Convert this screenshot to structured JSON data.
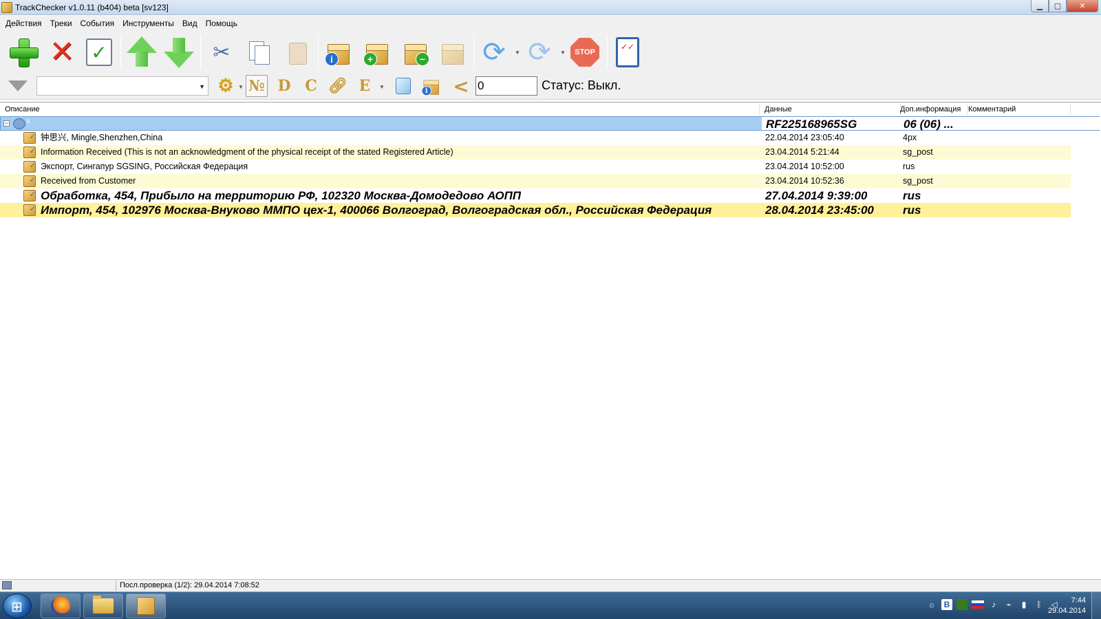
{
  "window": {
    "title": "TrackChecker v1.0.11 (b404) beta [sv123]",
    "min_glyph": "▁",
    "max_glyph": "▢",
    "close_glyph": "✕"
  },
  "menu": [
    "Действия",
    "Треки",
    "События",
    "Инструменты",
    "Вид",
    "Помощь"
  ],
  "toolbar2": {
    "filter_value": "",
    "num_button": "№",
    "d_button": "D",
    "c_button": "C",
    "e_button": "E",
    "lt_glyph": "<",
    "interval_value": "0",
    "status_label": "Статус: Выкл."
  },
  "toolbar1": {
    "stop_label": "STOP"
  },
  "table": {
    "columns": [
      "Описание",
      "Данные",
      "Доп.информация",
      "Комментарий"
    ],
    "group": {
      "count": "6",
      "track": "RF225168965SG",
      "info": "06 (06) ..."
    },
    "rows": [
      {
        "desc": "钟思兴, Mingle,Shenzhen,China",
        "date": "22.04.2014 23:05:40",
        "info": "4px"
      },
      {
        "desc": "Information Received (This is not an acknowledgment of the physical receipt of the stated Registered Article)",
        "date": "23.04.2014 5:21:44",
        "info": "sg_post"
      },
      {
        "desc": "Экспорт, Сингапур SGSING, Российская Федерация",
        "date": "23.04.2014 10:52:00",
        "info": "rus"
      },
      {
        "desc": "Received from Customer",
        "date": "23.04.2014 10:52:36",
        "info": "sg_post"
      },
      {
        "desc": "Обработка, 454, Прибыло на территорию РФ, 102320 Москва-Домодедово АОПП",
        "date": "27.04.2014 9:39:00",
        "info": "rus"
      },
      {
        "desc": "Импорт, 454, 102976 Москва-Внуково ММПО цех-1, 400066 Волгоград, Волгоградская обл., Российская Федерация",
        "date": "28.04.2014 23:45:00",
        "info": "rus"
      }
    ]
  },
  "statusbar": {
    "last_check": "Посл.проверка (1/2): 29.04.2014 7:08:52"
  },
  "taskbar": {
    "tray_b": "B",
    "time": "7:44",
    "date": "29.04.2014"
  }
}
